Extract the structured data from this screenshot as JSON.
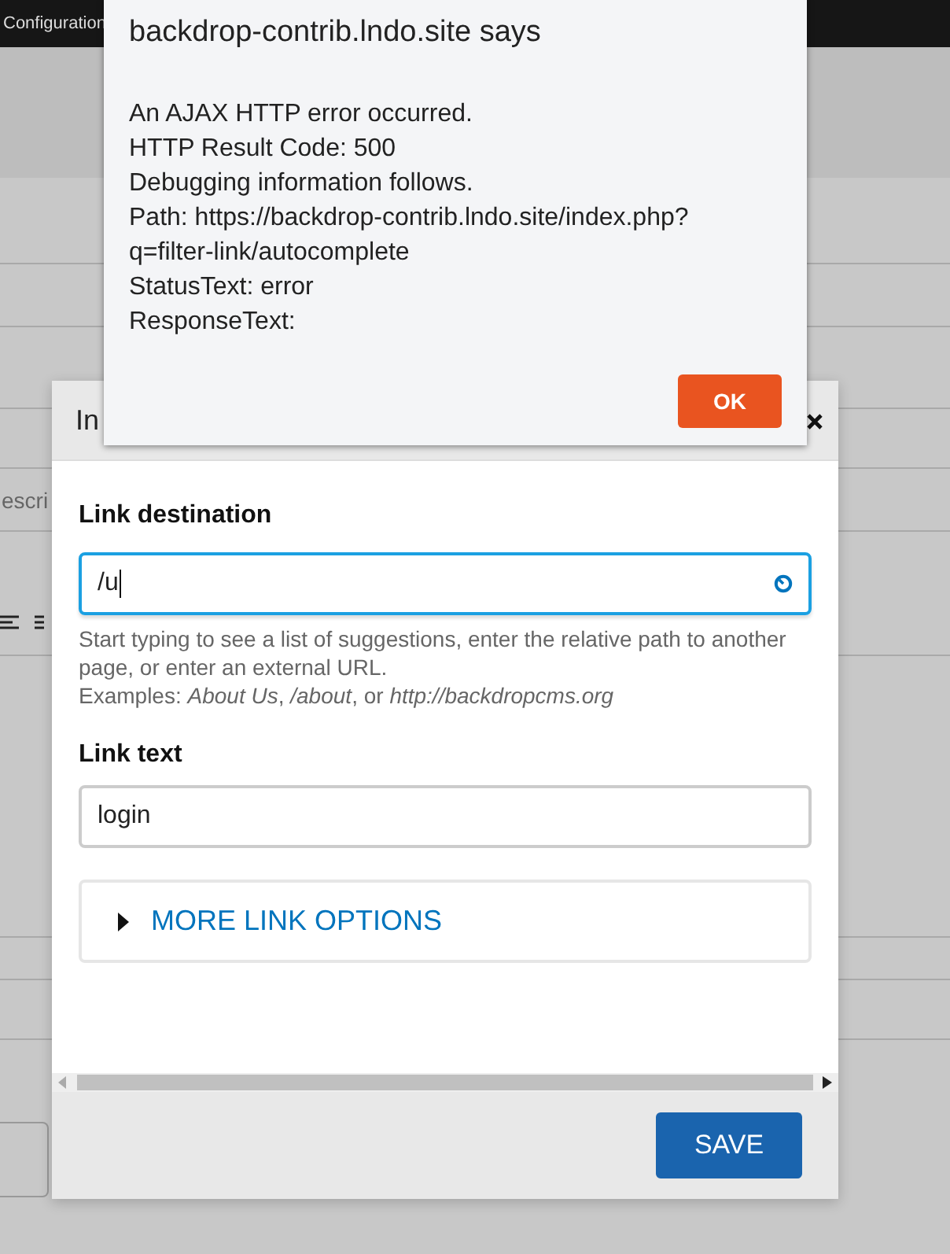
{
  "background_page": {
    "toolbar_text": "Configuration",
    "partial_text": "escri"
  },
  "link_dialog": {
    "title": "In",
    "fields": [
      {
        "kind": "autocomplete",
        "label": "Link destination",
        "value": "/u",
        "focused": true,
        "help": [
          "Start typing to see a list of suggestions, enter the relative path to another page, or enter an external URL.",
          "Examples: *About Us*, */about*, or *http://backdropcms.org*"
        ]
      },
      {
        "kind": "text",
        "label": "Link text",
        "value": "login",
        "focused": false
      }
    ],
    "details": {
      "summary": "MORE LINK OPTIONS",
      "expanded": false
    },
    "buttons": [
      "SAVE"
    ]
  },
  "alert": {
    "title": "backdrop-contrib.lndo.site says",
    "lines": [
      "An AJAX HTTP error occurred.",
      "HTTP Result Code: 500",
      "Debugging information follows.",
      "Path: https://backdrop-contrib.lndo.site/index.php?",
      "q=filter-link/autocomplete",
      "StatusText: error",
      "ResponseText:"
    ],
    "buttons": [
      "OK"
    ]
  }
}
